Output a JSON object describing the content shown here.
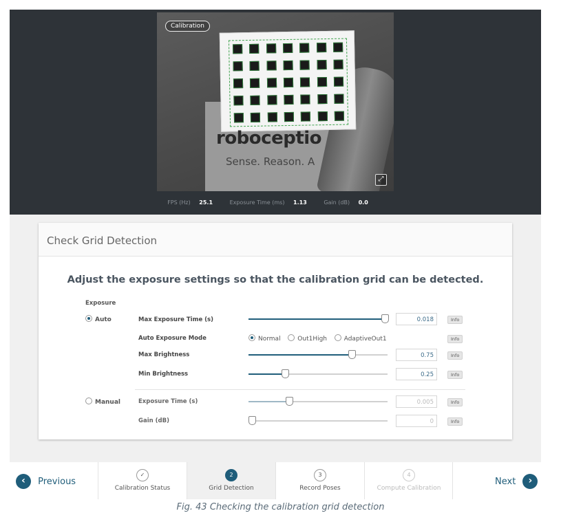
{
  "camera": {
    "badge": "Calibration",
    "logo_text": "roboceptio",
    "tagline": "Sense. Reason. A",
    "stats": [
      {
        "label": "FPS (Hz)",
        "value": "25.1"
      },
      {
        "label": "Exposure Time (ms)",
        "value": "1.13"
      },
      {
        "label": "Gain (dB)",
        "value": "0.0"
      }
    ]
  },
  "card": {
    "title": "Check Grid Detection",
    "instruction": "Adjust the exposure settings so that the calibration grid can be detected.",
    "section_label": "Exposure",
    "auto_label": "Auto",
    "manual_label": "Manual",
    "info_label": "Info",
    "rows": {
      "max_exposure": {
        "label": "Max Exposure Time (s)",
        "value": "0.018",
        "level": 1.0
      },
      "auto_mode": {
        "label": "Auto Exposure Mode",
        "options": [
          "Normal",
          "Out1High",
          "AdaptiveOut1"
        ],
        "selected": "Normal"
      },
      "max_brightness": {
        "label": "Max Brightness",
        "value": "0.75",
        "level": 0.75
      },
      "min_brightness": {
        "label": "Min Brightness",
        "value": "0.25",
        "level": 0.25
      },
      "exposure_time": {
        "label": "Exposure Time (s)",
        "value": "0.005",
        "level": 0.28
      },
      "gain": {
        "label": "Gain (dB)",
        "value": "0",
        "level": 0.0
      }
    }
  },
  "wizard": {
    "previous": "Previous",
    "next": "Next",
    "steps": [
      {
        "num": "✓",
        "label": "Calibration Status"
      },
      {
        "num": "2",
        "label": "Grid Detection"
      },
      {
        "num": "3",
        "label": "Record Poses"
      },
      {
        "num": "4",
        "label": "Compute Calibration"
      }
    ]
  },
  "caption": "Fig. 43 Checking the calibration grid detection",
  "colors": {
    "accent": "#1f5d7a",
    "header_bg": "#2e3338"
  }
}
